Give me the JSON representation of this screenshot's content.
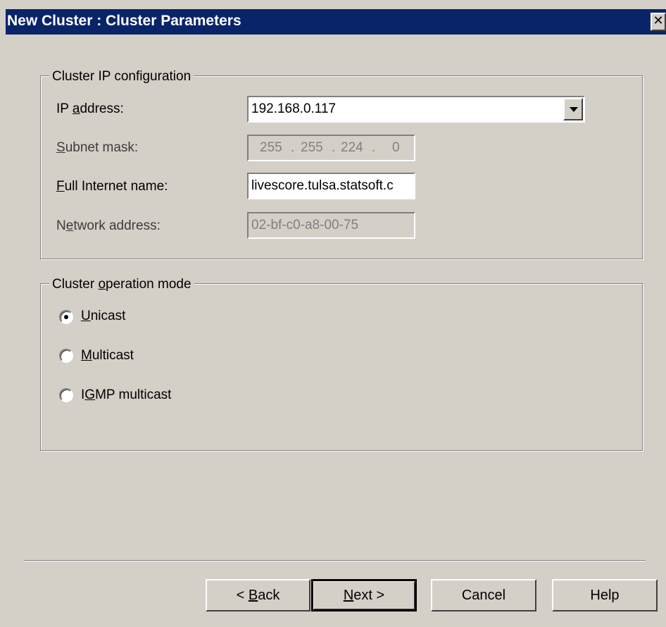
{
  "window": {
    "title": "New Cluster : Cluster Parameters",
    "close_glyph": "✕"
  },
  "ip_group": {
    "legend": "Cluster IP configuration",
    "ip_address": {
      "label_pre": "IP ",
      "label_u": "a",
      "label_post": "ddress:",
      "value": "192.168.0.117"
    },
    "subnet_mask": {
      "label_pre": "",
      "label_u": "S",
      "label_post": "ubnet mask:",
      "segments": [
        "255",
        ".",
        "255",
        ".",
        "224",
        ".",
        "0"
      ]
    },
    "full_internet_name": {
      "label_pre": "",
      "label_u": "F",
      "label_post": "ull Internet name:",
      "value": "livescore.tulsa.statsoft.c"
    },
    "network_address": {
      "label_pre": "N",
      "label_u": "e",
      "label_post": "twork address:",
      "value": "02-bf-c0-a8-00-75"
    }
  },
  "mode_group": {
    "legend_pre": "Cluster ",
    "legend_u": "o",
    "legend_post": "peration mode",
    "options": [
      {
        "pre": "",
        "u": "U",
        "post": "nicast",
        "selected": true
      },
      {
        "pre": "",
        "u": "M",
        "post": "ulticast",
        "selected": false
      },
      {
        "pre": "I",
        "u": "G",
        "post": "MP multicast",
        "selected": false
      }
    ]
  },
  "buttons": {
    "back": {
      "pre": "< ",
      "u": "B",
      "post": "ack"
    },
    "next": {
      "pre": "",
      "u": "N",
      "post": "ext >"
    },
    "cancel": "Cancel",
    "help": "Help"
  }
}
